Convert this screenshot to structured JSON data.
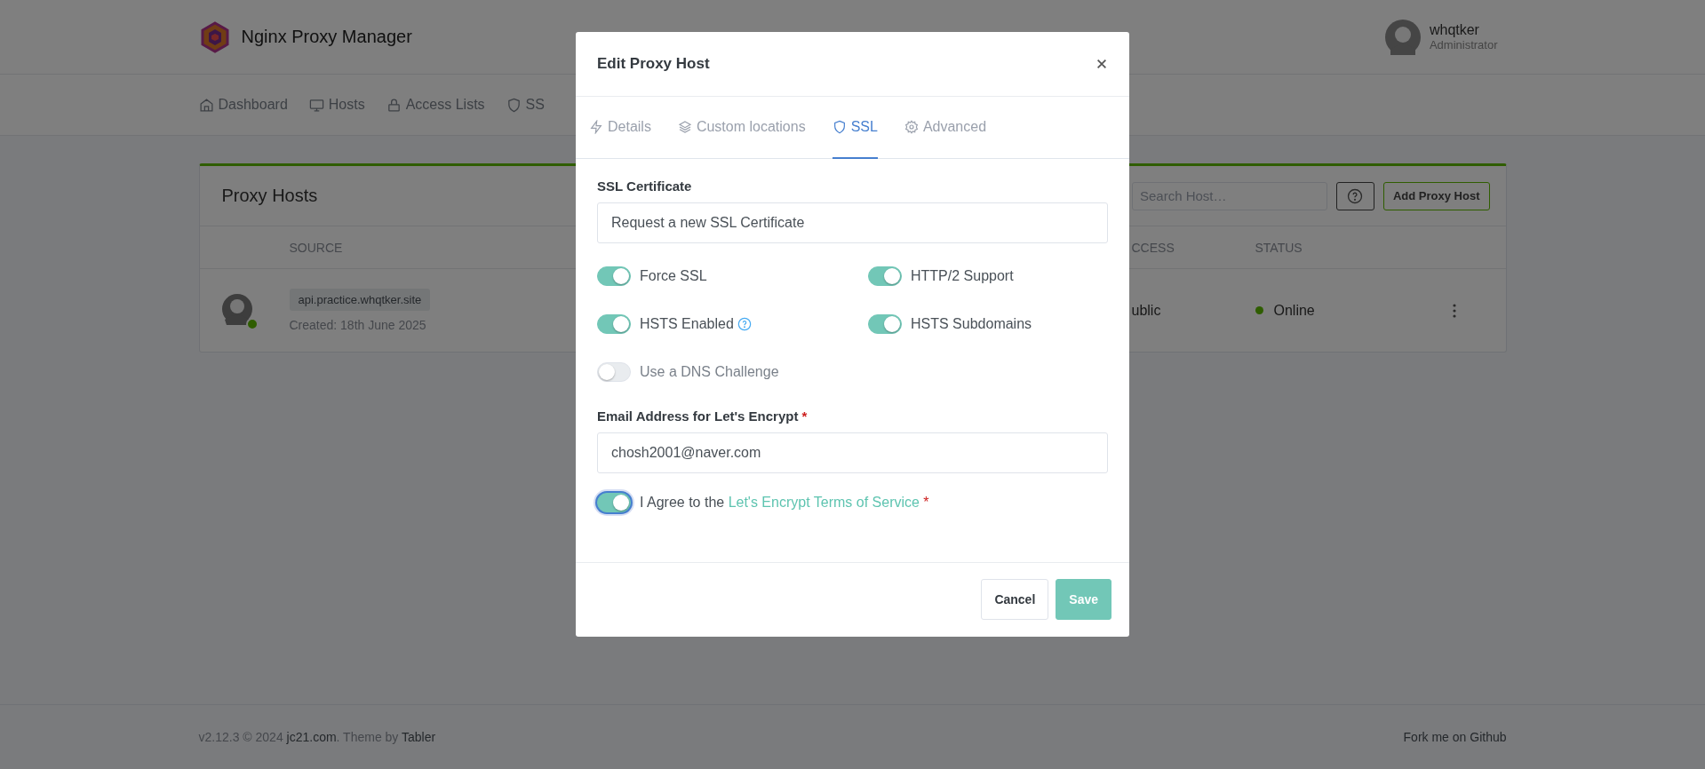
{
  "app": {
    "title": "Nginx Proxy Manager"
  },
  "user": {
    "name": "whqtker",
    "role": "Administrator"
  },
  "nav": [
    {
      "label": "Dashboard",
      "kind": "home"
    },
    {
      "label": "Hosts",
      "kind": "monitor"
    },
    {
      "label": "Access Lists",
      "kind": "lock"
    },
    {
      "label": "SS",
      "kind": "shield"
    }
  ],
  "card": {
    "title": "Proxy Hosts",
    "search": {
      "placeholder": "Search Host…"
    },
    "add_button": "Add Proxy Host",
    "columns": [
      "SOURCE",
      "CCESS",
      "STATUS"
    ],
    "rows": [
      {
        "source": "api.practice.whqtker.site",
        "created": "Created: 18th June 2025",
        "online": true,
        "access": "ublic",
        "status": "Online"
      }
    ]
  },
  "modal": {
    "title": "Edit Proxy Host",
    "tabs": [
      {
        "label": "Details",
        "kind": "bolt",
        "selected": false
      },
      {
        "label": "Custom locations",
        "kind": "layers",
        "selected": false
      },
      {
        "label": "SSL",
        "kind": "shield",
        "selected": true
      },
      {
        "label": "Advanced",
        "kind": "gear",
        "selected": false
      }
    ],
    "certificate": {
      "label": "SSL Certificate",
      "value": "Request a new SSL Certificate"
    },
    "toggles": [
      {
        "label": "Force SSL",
        "on": true,
        "help": false
      },
      {
        "label": "HTTP/2 Support",
        "on": true,
        "help": false
      },
      {
        "label": "HSTS Enabled",
        "on": true,
        "help": true
      },
      {
        "label": "HSTS Subdomains",
        "on": true,
        "help": false
      },
      {
        "label": "Use a DNS Challenge",
        "on": false,
        "help": false
      }
    ],
    "email": {
      "label": "Email Address for Let's Encrypt",
      "required_mark": "*",
      "value": "chosh2001@naver.com"
    },
    "agree": {
      "on": true,
      "focused": true,
      "parts": [
        {
          "kind": "plain",
          "text": "I Agree to the "
        },
        {
          "kind": "link",
          "text": "Let's Encrypt Terms of Service"
        },
        {
          "kind": "required",
          "text": " *"
        }
      ]
    },
    "buttons": [
      {
        "label": "Cancel",
        "kind": "secondary"
      },
      {
        "label": "Save",
        "kind": "primary"
      }
    ]
  },
  "footer": {
    "credits": [
      {
        "kind": "plain",
        "text": "v2.12.3 © 2024 "
      },
      {
        "kind": "link",
        "text": "jc21.com"
      },
      {
        "kind": "plain",
        "text": ". Theme by "
      },
      {
        "kind": "link",
        "text": "Tabler"
      }
    ],
    "fork_link": "Fork me on Github"
  }
}
